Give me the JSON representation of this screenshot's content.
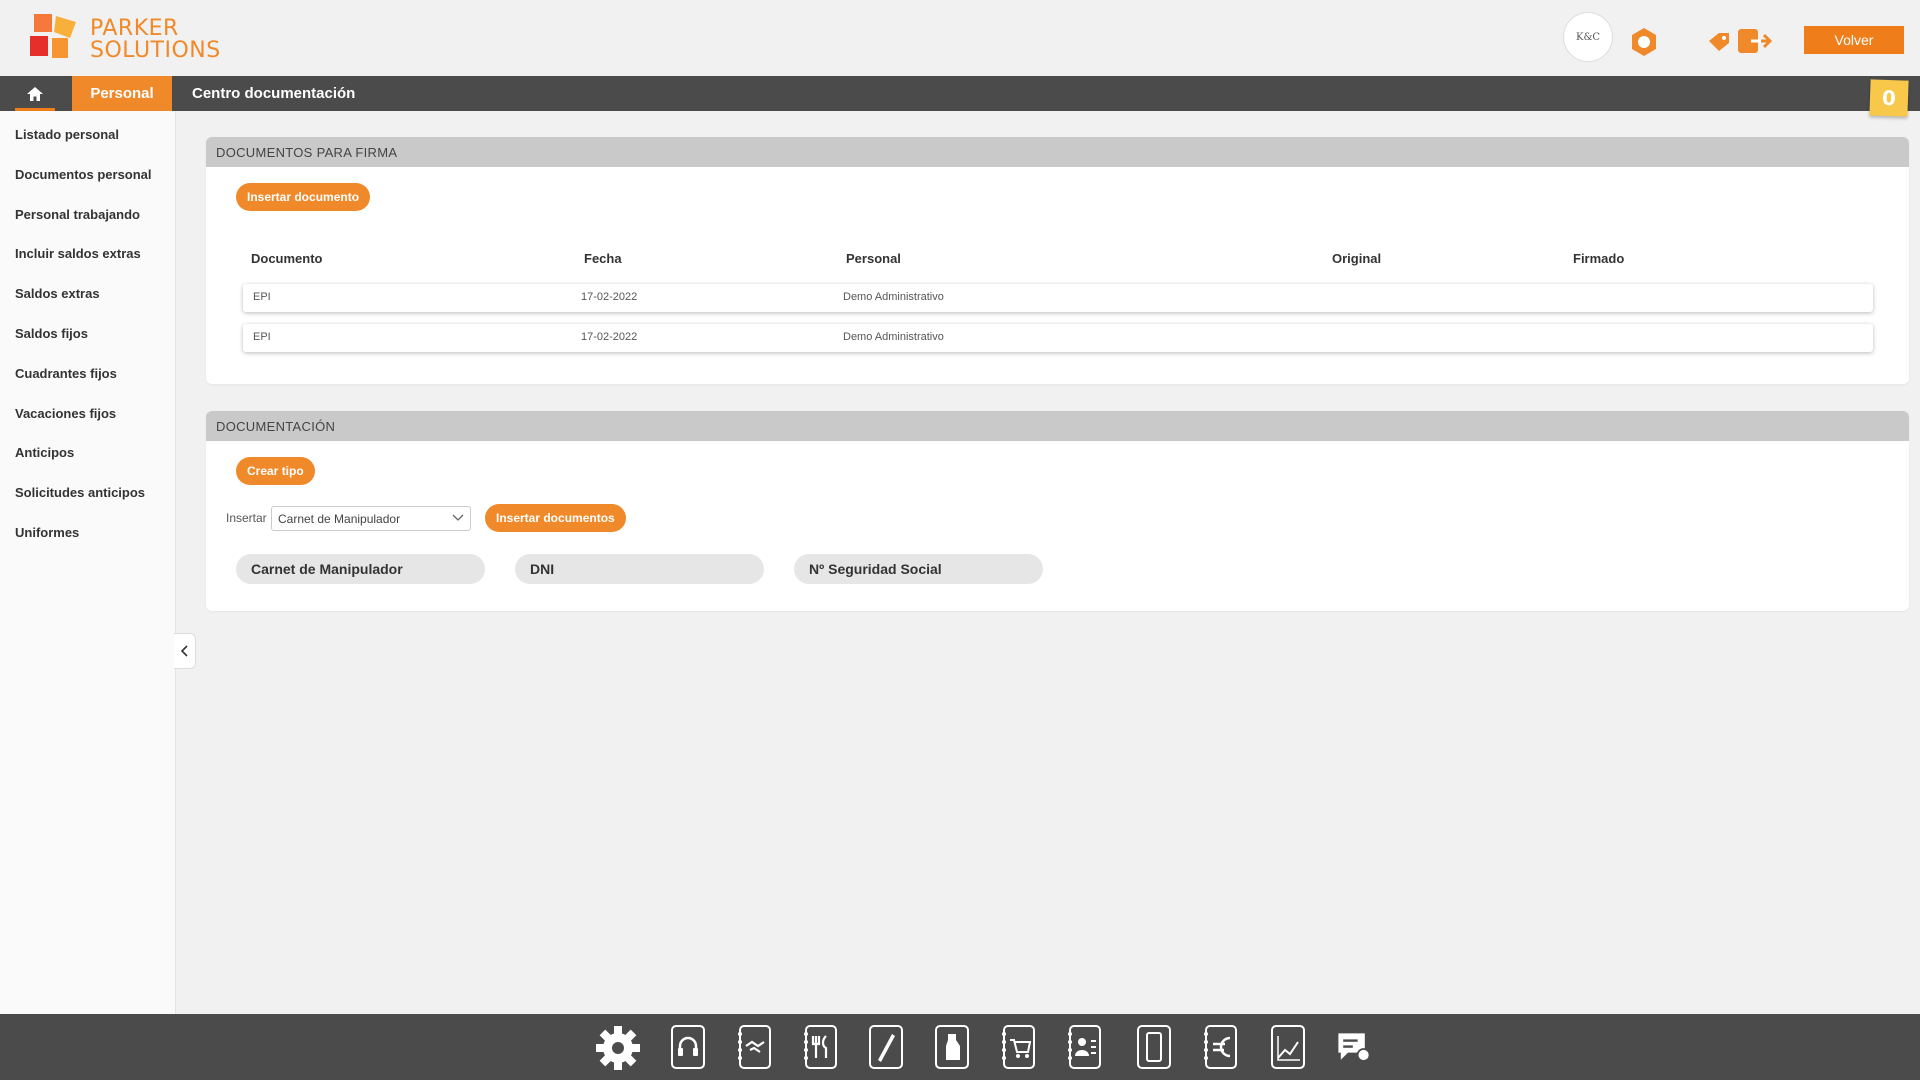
{
  "header": {
    "brand_line1": "PARKER",
    "brand_line2": "SOLUTIONS",
    "avatar_text": "K&C",
    "volver_label": "Volver"
  },
  "nav": {
    "personal_label": "Personal",
    "section_title": "Centro documentación",
    "notes_count": "0"
  },
  "sidebar": {
    "items": [
      "Listado personal",
      "Documentos personal",
      "Personal trabajando",
      "Incluir saldos extras",
      "Saldos extras",
      "Saldos fijos",
      "Cuadrantes fijos",
      "Vacaciones fijos",
      "Anticipos",
      "Solicitudes anticipos",
      "Uniformes"
    ]
  },
  "firma": {
    "title": "DOCUMENTOS PARA FIRMA",
    "insert_label": "Insertar documento",
    "columns": [
      "Documento",
      "Fecha",
      "Personal",
      "Original",
      "Firmado"
    ],
    "rows": [
      {
        "documento": "EPI",
        "fecha": "17-02-2022",
        "personal": "Demo Administrativo",
        "original": "",
        "firmado": ""
      },
      {
        "documento": "EPI",
        "fecha": "17-02-2022",
        "personal": "Demo Administrativo",
        "original": "",
        "firmado": ""
      }
    ]
  },
  "documentacion": {
    "title": "DOCUMENTACIÓN",
    "crear_tipo_label": "Crear tipo",
    "insertar_label": "Insertar",
    "selected_type": "Carnet de Manipulador",
    "insert_docs_label": "Insertar documentos",
    "types": [
      "Carnet de Manipulador",
      "DNI",
      "Nº Seguridad Social"
    ]
  },
  "colors": {
    "accent": "#f0892a",
    "dark_bar": "#4b4b4b",
    "panel_header": "#c9c9c9"
  },
  "bottom_icons": [
    "settings-icon",
    "headset-icon",
    "handshake-icon",
    "restaurant-icon",
    "pen-icon",
    "cleaning-icon",
    "cart-icon",
    "contacts-icon",
    "mobile-icon",
    "euro-icon",
    "chart-icon",
    "chat-user-icon"
  ]
}
